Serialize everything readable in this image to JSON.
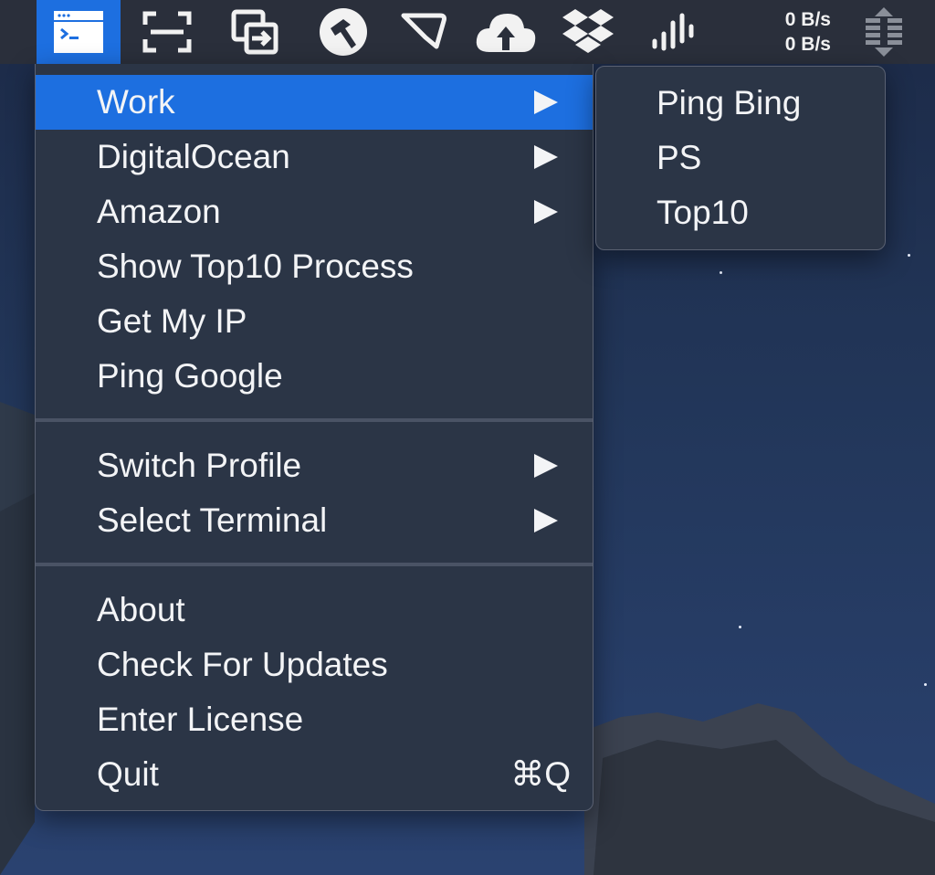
{
  "menubar": {
    "icons": [
      "terminal-app-icon",
      "screenshot-icon",
      "file-share-icon",
      "hammer-icon",
      "flag-icon",
      "cloud-upload-icon",
      "dropbox-icon",
      "soundwave-icon",
      "stats-icon"
    ],
    "net_up": "0 B/s",
    "net_down": "0 B/s"
  },
  "menu": {
    "items": [
      {
        "label": "Work",
        "submenu": true,
        "selected": true
      },
      {
        "label": "DigitalOcean",
        "submenu": true
      },
      {
        "label": "Amazon",
        "submenu": true
      },
      {
        "label": "Show Top10 Process"
      },
      {
        "label": "Get My IP"
      },
      {
        "label": "Ping Google"
      },
      {
        "label": "Switch Profile",
        "submenu": true
      },
      {
        "label": "Select Terminal",
        "submenu": true
      },
      {
        "label": "About"
      },
      {
        "label": "Check For Updates"
      },
      {
        "label": "Enter License"
      },
      {
        "label": "Quit",
        "shortcut": "⌘Q"
      }
    ]
  },
  "submenu": {
    "items": [
      {
        "label": "Ping Bing"
      },
      {
        "label": "PS"
      },
      {
        "label": "Top10"
      }
    ]
  },
  "colors": {
    "highlight": "#1d6fe0",
    "menu_bg": "#2b3546",
    "menubar_bg": "#2a2f3b"
  }
}
